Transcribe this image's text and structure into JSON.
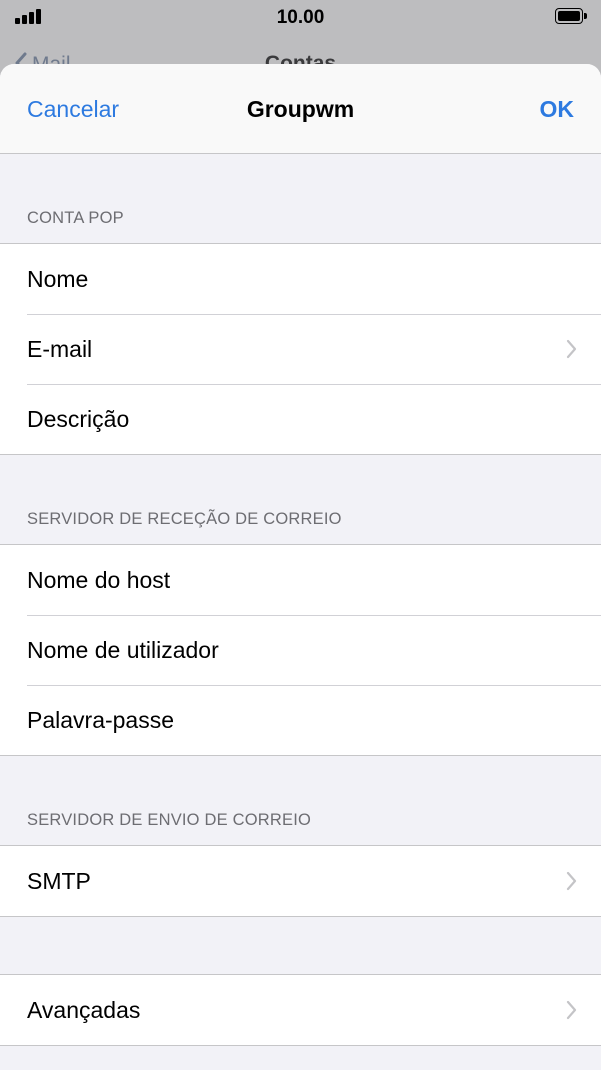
{
  "status_bar": {
    "time": "10.00",
    "signal_icon": "signal-bars-icon",
    "battery_icon": "battery-full-icon"
  },
  "background_nav": {
    "back_label": "Mail",
    "title": "Contas"
  },
  "sheet": {
    "nav": {
      "cancel_label": "Cancelar",
      "title": "Groupwm",
      "ok_label": "OK"
    },
    "sections": [
      {
        "header": "CONTA POP",
        "rows": [
          {
            "label": "Nome",
            "chevron": false
          },
          {
            "label": "E-mail",
            "chevron": true
          },
          {
            "label": "Descrição",
            "chevron": false
          }
        ]
      },
      {
        "header": "SERVIDOR DE RECEÇÃO DE CORREIO",
        "rows": [
          {
            "label": "Nome do host",
            "chevron": false
          },
          {
            "label": "Nome de utilizador",
            "chevron": false
          },
          {
            "label": "Palavra-passe",
            "chevron": false
          }
        ]
      },
      {
        "header": "SERVIDOR DE ENVIO DE CORREIO",
        "rows": [
          {
            "label": "SMTP",
            "chevron": true
          }
        ]
      },
      {
        "header": "",
        "rows": [
          {
            "label": "Avançadas",
            "chevron": true
          }
        ]
      }
    ]
  },
  "colors": {
    "accent": "#2d7ae0",
    "background": "#f2f2f7",
    "separator": "#c6c6c8",
    "header_text": "#6d6d72",
    "chevron": "#c4c4c7"
  }
}
